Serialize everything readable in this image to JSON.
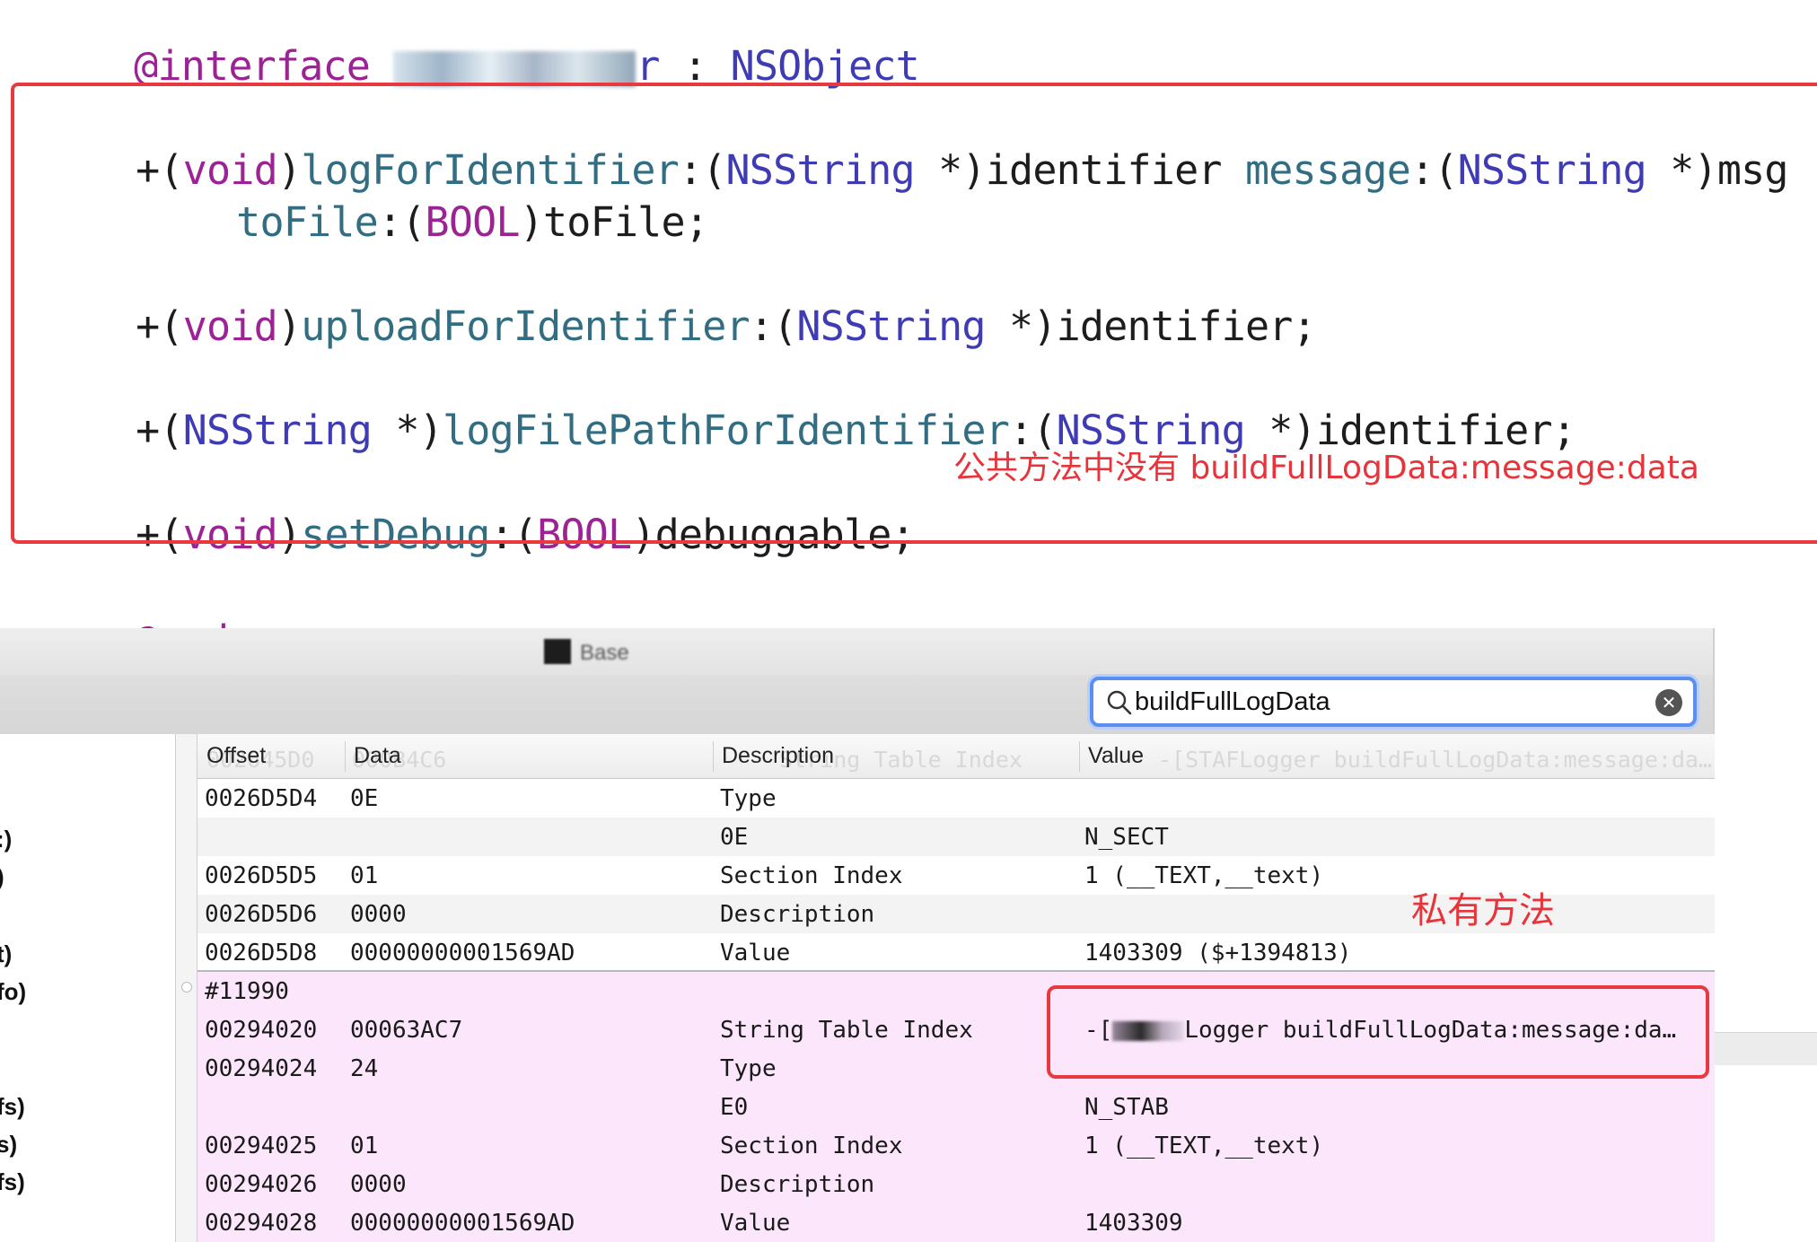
{
  "editor": {
    "gutter": [
      "",
      "",
      "",
      "",
      "",
      "",
      "",
      "",
      "",
      "",
      "",
      ""
    ],
    "interface_kw": "@interface",
    "interface_name_tail": "r",
    "interface_colon": " : ",
    "interface_super": "NSObject",
    "m1_plus": "+(",
    "m1_ret": "void",
    "m1_close": ")",
    "m1_name": "logForIdentifier",
    "m1_p1a": ":(",
    "m1_type1": "NSString",
    "m1_p1b": " *)identifier ",
    "m1_name2": "message",
    "m1_p2a": ":(",
    "m1_type2": "NSString",
    "m1_p2b": " *)msg",
    "m1_name3": "toFile",
    "m1_p3a": ":(",
    "m1_type3": "BOOL",
    "m1_p3b": ")toFile;",
    "m2_plus": "+(",
    "m2_ret": "void",
    "m2_close": ")",
    "m2_name": "uploadForIdentifier",
    "m2_p1a": ":(",
    "m2_type1": "NSString",
    "m2_p1b": " *)identifier;",
    "m3_plus": "+(",
    "m3_ret": "NSString",
    "m3_close": " *)",
    "m3_name": "logFilePathForIdentifier",
    "m3_p1a": ":(",
    "m3_type1": "NSString",
    "m3_p1b": " *)identifier;",
    "m4_plus": "+(",
    "m4_ret": "void",
    "m4_close": ")",
    "m4_name": "setDebug",
    "m4_p1a": ":(",
    "m4_type1": "BOOL",
    "m4_p1b": ")debuggable;",
    "end_kw": "@end"
  },
  "annotations": {
    "public_note": "公共方法中没有 buildFullLogData:message:data",
    "private_note": "私有方法",
    "accent_color": "#e8333a"
  },
  "window": {
    "title_tail": "Base"
  },
  "search": {
    "value": "buildFullLogData",
    "placeholder": ""
  },
  "sidebar": {
    "items": [
      ":)",
      ")",
      "t)",
      "fo)",
      "fs)",
      "s)",
      "fs)"
    ]
  },
  "table": {
    "headers": {
      "offset": "Offset",
      "data": "Data",
      "description": "Description",
      "value": "Value"
    },
    "ghost_header": {
      "offset": "002645D0",
      "data": "000B4C6",
      "description": "String Table Index",
      "value": "-[STAFLogger buildFullLogData:message:da…"
    },
    "rows": [
      {
        "offset": "0026D5D4",
        "data": "0E",
        "description": "Type",
        "value": ""
      },
      {
        "offset": "",
        "data": "",
        "description": "0E",
        "value": "N_SECT"
      },
      {
        "offset": "0026D5D5",
        "data": "01",
        "description": "Section Index",
        "value": "1 (__TEXT,__text)"
      },
      {
        "offset": "0026D5D6",
        "data": "0000",
        "description": "Description",
        "value": ""
      },
      {
        "offset": "0026D5D8",
        "data": "00000000001569AD",
        "description": "Value",
        "value": "1403309 ($+1394813)"
      },
      {
        "offset": "#11990",
        "data": "",
        "description": "",
        "value": ""
      },
      {
        "offset": "00294020",
        "data": "00063AC7",
        "description": "String Table Index",
        "value_prefix": "-[",
        "value": "Logger buildFullLogData:message:da…"
      },
      {
        "offset": "00294024",
        "data": "24",
        "description": "Type",
        "value": ""
      },
      {
        "offset": "",
        "data": "",
        "description": "E0",
        "value": "N_STAB"
      },
      {
        "offset": "00294025",
        "data": "01",
        "description": "Section Index",
        "value": "1 (__TEXT,__text)"
      },
      {
        "offset": "00294026",
        "data": "0000",
        "description": "Description",
        "value": ""
      },
      {
        "offset": "00294028",
        "data": "00000000001569AD",
        "description": "Value",
        "value": "1403309"
      }
    ]
  }
}
